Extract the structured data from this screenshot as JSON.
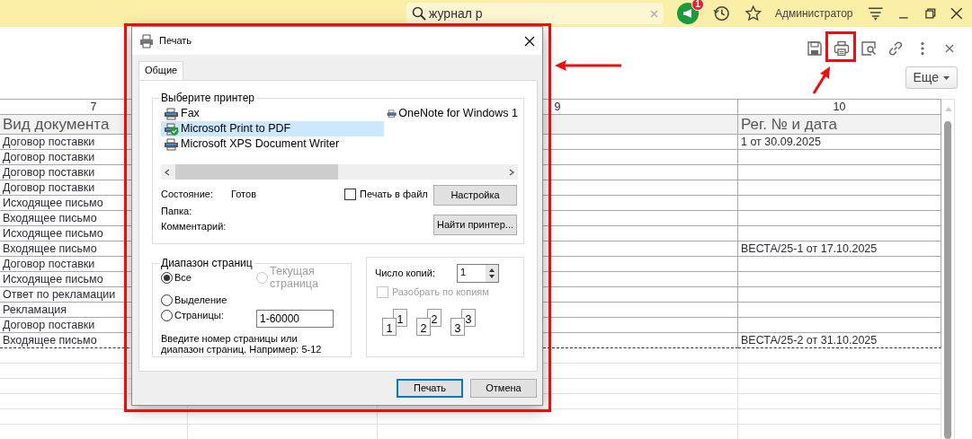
{
  "top_bar": {
    "search": {
      "value": "журнал р"
    },
    "notifications": {
      "count": "1"
    },
    "user": "Администратор"
  },
  "toolbar": {
    "more_button": "Еще"
  },
  "sheet": {
    "columns": [
      {
        "number": "7",
        "caption": "Вид документа"
      },
      {
        "number": "9"
      },
      {
        "number": "10",
        "caption": "Рег. № и дата"
      }
    ],
    "rows": [
      {
        "doc_type": "Договор поставки",
        "reg": "1 от 30.09.2025"
      },
      {
        "doc_type": "Договор поставки"
      },
      {
        "doc_type": "Договор поставки"
      },
      {
        "doc_type": "Договор поставки"
      },
      {
        "doc_type": "Исходящее письмо"
      },
      {
        "doc_type": "Входящее письмо"
      },
      {
        "doc_type": "Исходящее письмо"
      },
      {
        "doc_type": "Входящее письмо",
        "reg": "ВЕСТА/25-1 от 17.10.2025"
      },
      {
        "doc_type": "Договор поставки"
      },
      {
        "doc_type": "Исходящее письмо"
      },
      {
        "doc_type": "Ответ по рекламации"
      },
      {
        "doc_type": "Рекламация"
      },
      {
        "doc_type": "Договор поставки"
      },
      {
        "doc_type": "Входящее письмо",
        "reg": "ВЕСТА/25-2 от 31.10.2025"
      }
    ]
  },
  "dialog": {
    "title": "Печать",
    "tabs": [
      {
        "label": "Общие",
        "selected": true
      }
    ],
    "printer_group": {
      "title": "Выберите принтер",
      "printers": [
        {
          "name": "Fax",
          "selected": false,
          "default": false
        },
        {
          "name": "Microsoft Print to PDF",
          "selected": true,
          "default": true
        },
        {
          "name": "Microsoft XPS Document Writer",
          "selected": false,
          "default": false
        },
        {
          "name": "OneNote for Windows 1",
          "selected": false,
          "default": false
        }
      ],
      "status_label": "Состояние:",
      "status_value": "Готов",
      "folder_label": "Папка:",
      "comment_label": "Комментарий:",
      "print_to_file": {
        "label": "Печать в файл",
        "checked": false
      },
      "setup_button": "Настройка",
      "find_button": "Найти принтер..."
    },
    "range_group": {
      "title": "Диапазон страниц",
      "options": [
        {
          "label": "Все",
          "selected": true,
          "disabled": false
        },
        {
          "label": "Текущая страница",
          "selected": false,
          "disabled": true
        },
        {
          "label": "Выделение",
          "selected": false,
          "disabled": false
        },
        {
          "label": "Страницы:",
          "selected": false,
          "disabled": false
        }
      ],
      "pages": "1-60000",
      "hint": "Введите номер страницы или диапазон страниц.  Например: 5-12"
    },
    "copies_group": {
      "label": "Число копий:",
      "value": "1",
      "collate": {
        "label": "Разобрать по копиям",
        "checked": false,
        "disabled": true
      },
      "collate_pages": [
        {
          "back": "1",
          "front": "1"
        },
        {
          "back": "2",
          "front": "2"
        },
        {
          "back": "3",
          "front": "3"
        }
      ]
    },
    "buttons": [
      {
        "label": "Печать",
        "kind": "default"
      },
      {
        "label": "Отмена",
        "kind": "normal"
      }
    ]
  }
}
